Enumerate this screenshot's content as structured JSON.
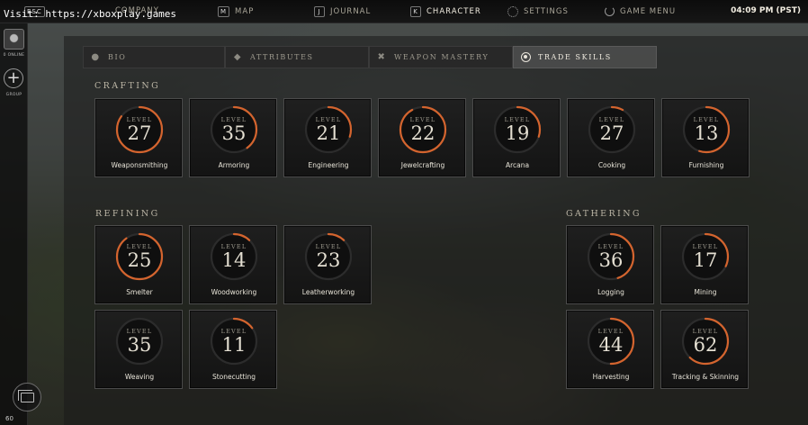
{
  "watermark": "Visit: https://xboxplay.games",
  "topbar": {
    "nav": [
      {
        "key": "ESC",
        "label": ""
      },
      {
        "key": "",
        "label": "COMPANY"
      },
      {
        "key": "M",
        "label": "MAP"
      },
      {
        "key": "J",
        "label": "JOURNAL"
      },
      {
        "key": "K",
        "label": "CHARACTER"
      },
      {
        "key": "",
        "label": "SETTINGS"
      },
      {
        "key": "",
        "label": "GAME MENU"
      }
    ],
    "clock": "04:09 PM (PST)"
  },
  "leftstrip": {
    "online_label": "0 ONLINE",
    "group_label": "GROUP",
    "fps": "60"
  },
  "tabs": [
    {
      "label": "BIO",
      "icon": "person-icon"
    },
    {
      "label": "ATTRIBUTES",
      "icon": "diamond-icon"
    },
    {
      "label": "WEAPON MASTERY",
      "icon": "crossed-swords-icon"
    },
    {
      "label": "TRADE SKILLS",
      "icon": "target-icon"
    }
  ],
  "active_tab": "TRADE SKILLS",
  "level_word": "LEVEL",
  "accent_color": "#d4642e",
  "sections": {
    "crafting": {
      "title": "CRAFTING",
      "skills": [
        {
          "name": "Weaponsmithing",
          "level": "27",
          "progress": 0.85
        },
        {
          "name": "Armoring",
          "level": "35",
          "progress": 0.4
        },
        {
          "name": "Engineering",
          "level": "21",
          "progress": 0.3
        },
        {
          "name": "Jewelcrafting",
          "level": "22",
          "progress": 0.92
        },
        {
          "name": "Arcana",
          "level": "19",
          "progress": 0.3
        },
        {
          "name": "Cooking",
          "level": "27",
          "progress": 0.08
        },
        {
          "name": "Furnishing",
          "level": "13",
          "progress": 0.55
        }
      ]
    },
    "refining": {
      "title": "REFINING",
      "skills": [
        {
          "name": "Smelter",
          "level": "25",
          "progress": 0.9
        },
        {
          "name": "Woodworking",
          "level": "14",
          "progress": 0.12
        },
        {
          "name": "Leatherworking",
          "level": "23",
          "progress": 0.12
        },
        {
          "name": "Weaving",
          "level": "35",
          "progress": 0.0
        },
        {
          "name": "Stonecutting",
          "level": "11",
          "progress": 0.15
        }
      ]
    },
    "gathering": {
      "title": "GATHERING",
      "skills": [
        {
          "name": "Logging",
          "level": "36",
          "progress": 0.45
        },
        {
          "name": "Mining",
          "level": "17",
          "progress": 0.32
        },
        {
          "name": "Harvesting",
          "level": "44",
          "progress": 0.5
        },
        {
          "name": "Tracking & Skinning",
          "level": "62",
          "progress": 0.62
        }
      ]
    }
  }
}
